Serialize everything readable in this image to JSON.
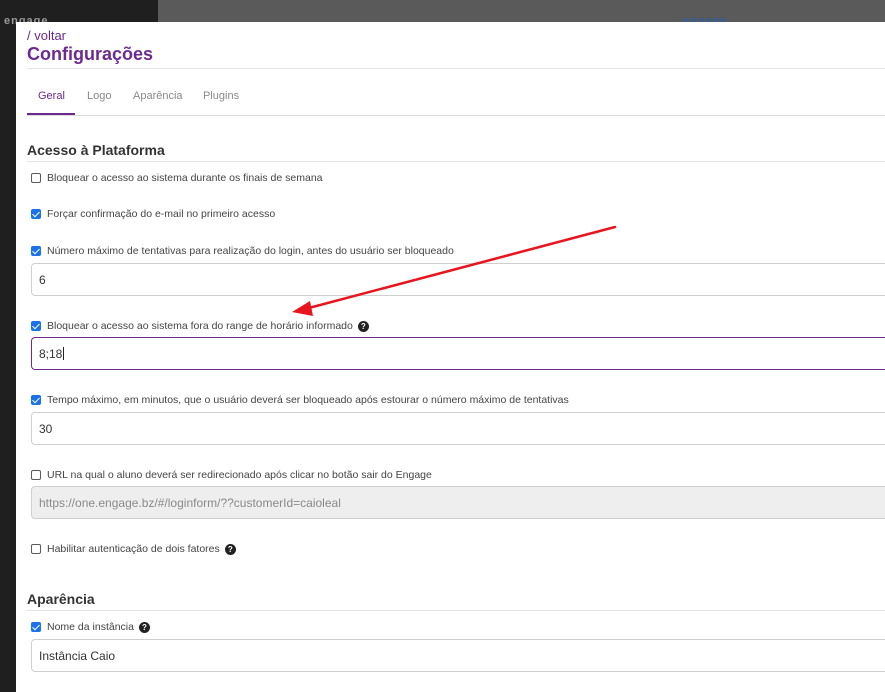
{
  "background": {
    "logo_text": "engage"
  },
  "header": {
    "back_link": "/ voltar",
    "title": "Configurações"
  },
  "tabs": [
    {
      "label": "Geral",
      "active": true
    },
    {
      "label": "Logo",
      "active": false
    },
    {
      "label": "Aparência",
      "active": false
    },
    {
      "label": "Plugins",
      "active": false
    }
  ],
  "sections": {
    "acesso": {
      "title": "Acesso à Plataforma",
      "options": [
        {
          "label": "Bloquear o acesso ao sistema durante os finais de semana",
          "checked": false
        },
        {
          "label": "Forçar confirmação do e-mail no primeiro acesso",
          "checked": true
        },
        {
          "label": "Número máximo de tentativas para realização do login, antes do usuário ser bloqueado",
          "checked": true,
          "value": "6"
        },
        {
          "label": "Bloquear o acesso ao sistema fora do range de horário informado",
          "checked": true,
          "value": "8;18"
        },
        {
          "label": "Tempo máximo, em minutos, que o usuário deverá ser bloqueado após estourar o número máximo de tentativas",
          "checked": true,
          "value": "30"
        },
        {
          "label": "URL na qual o aluno deverá ser redirecionado após clicar no botão sair do Engage",
          "checked": false,
          "placeholder": "https://one.engage.bz/#/loginform/??customerId=caioleal"
        },
        {
          "label": "Habilitar autenticação de dois fatores",
          "checked": false
        }
      ]
    },
    "aparencia": {
      "title": "Aparência",
      "options": [
        {
          "label": "Nome da instância",
          "checked": true,
          "value": "Instância Caio"
        }
      ]
    }
  },
  "colors": {
    "brand": "#6c2a8f",
    "checkbox": "#1a73e8",
    "annotation_arrow": "#e8141e"
  },
  "icons": [
    "help-icon",
    "check-icon",
    "annotation-arrow-icon"
  ]
}
